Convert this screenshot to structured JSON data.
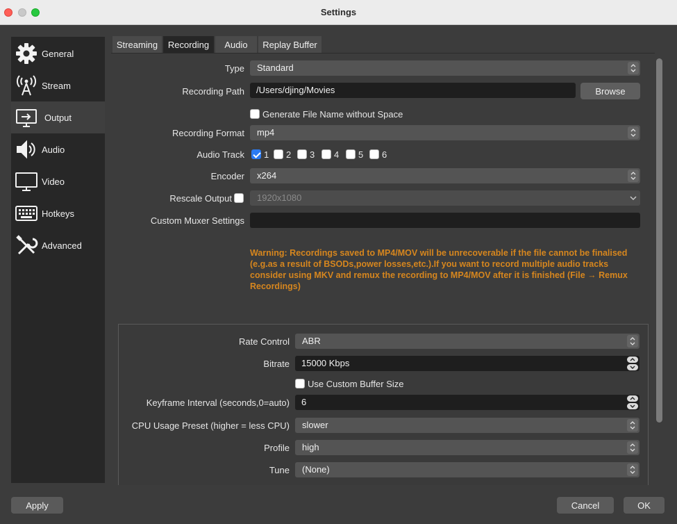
{
  "window": {
    "title": "Settings"
  },
  "sidebar": {
    "items": [
      {
        "label": "General",
        "icon": "gear-icon"
      },
      {
        "label": "Stream",
        "icon": "antenna-icon"
      },
      {
        "label": "Output",
        "icon": "monitor-output-icon",
        "active": true
      },
      {
        "label": "Audio",
        "icon": "speaker-icon"
      },
      {
        "label": "Video",
        "icon": "monitor-icon"
      },
      {
        "label": "Hotkeys",
        "icon": "keyboard-icon"
      },
      {
        "label": "Advanced",
        "icon": "tools-icon"
      }
    ]
  },
  "tabs": [
    "Streaming",
    "Recording",
    "Audio",
    "Replay Buffer"
  ],
  "active_tab": "Recording",
  "recording": {
    "type_label": "Type",
    "type_value": "Standard",
    "path_label": "Recording Path",
    "path_value": "/Users/djing/Movies",
    "browse_label": "Browse",
    "gen_filename_label": "Generate File Name without Space",
    "gen_filename_checked": false,
    "format_label": "Recording Format",
    "format_value": "mp4",
    "audio_track_label": "Audio Track",
    "tracks": [
      {
        "label": "1",
        "checked": true
      },
      {
        "label": "2",
        "checked": false
      },
      {
        "label": "3",
        "checked": false
      },
      {
        "label": "4",
        "checked": false
      },
      {
        "label": "5",
        "checked": false
      },
      {
        "label": "6",
        "checked": false
      }
    ],
    "encoder_label": "Encoder",
    "encoder_value": "x264",
    "rescale_label": "Rescale Output",
    "rescale_checked": false,
    "rescale_value": "1920x1080",
    "muxer_label": "Custom Muxer Settings",
    "muxer_value": "",
    "warning": "Warning: Recordings saved to MP4/MOV will be unrecoverable if the file cannot be finalised (e.g.as a result of BSODs,power losses,etc.).If you want to record multiple audio tracks consider using MKV and remux the recording to MP4/MOV after it is finished (File → Remux Recordings)"
  },
  "encoder_settings": {
    "rate_control_label": "Rate Control",
    "rate_control_value": "ABR",
    "bitrate_label": "Bitrate",
    "bitrate_value": "15000 Kbps",
    "buffer_label": "Use Custom Buffer Size",
    "buffer_checked": false,
    "keyframe_label": "Keyframe Interval (seconds,0=auto)",
    "keyframe_value": "6",
    "cpu_label": "CPU Usage Preset (higher = less CPU)",
    "cpu_value": "slower",
    "profile_label": "Profile",
    "profile_value": "high",
    "tune_label": "Tune",
    "tune_value": "(None)"
  },
  "footer": {
    "apply": "Apply",
    "cancel": "Cancel",
    "ok": "OK"
  },
  "colors": {
    "warning": "#d6861e",
    "checkbox_on": "#2b7bf3",
    "sidebar_bg": "#272727"
  }
}
